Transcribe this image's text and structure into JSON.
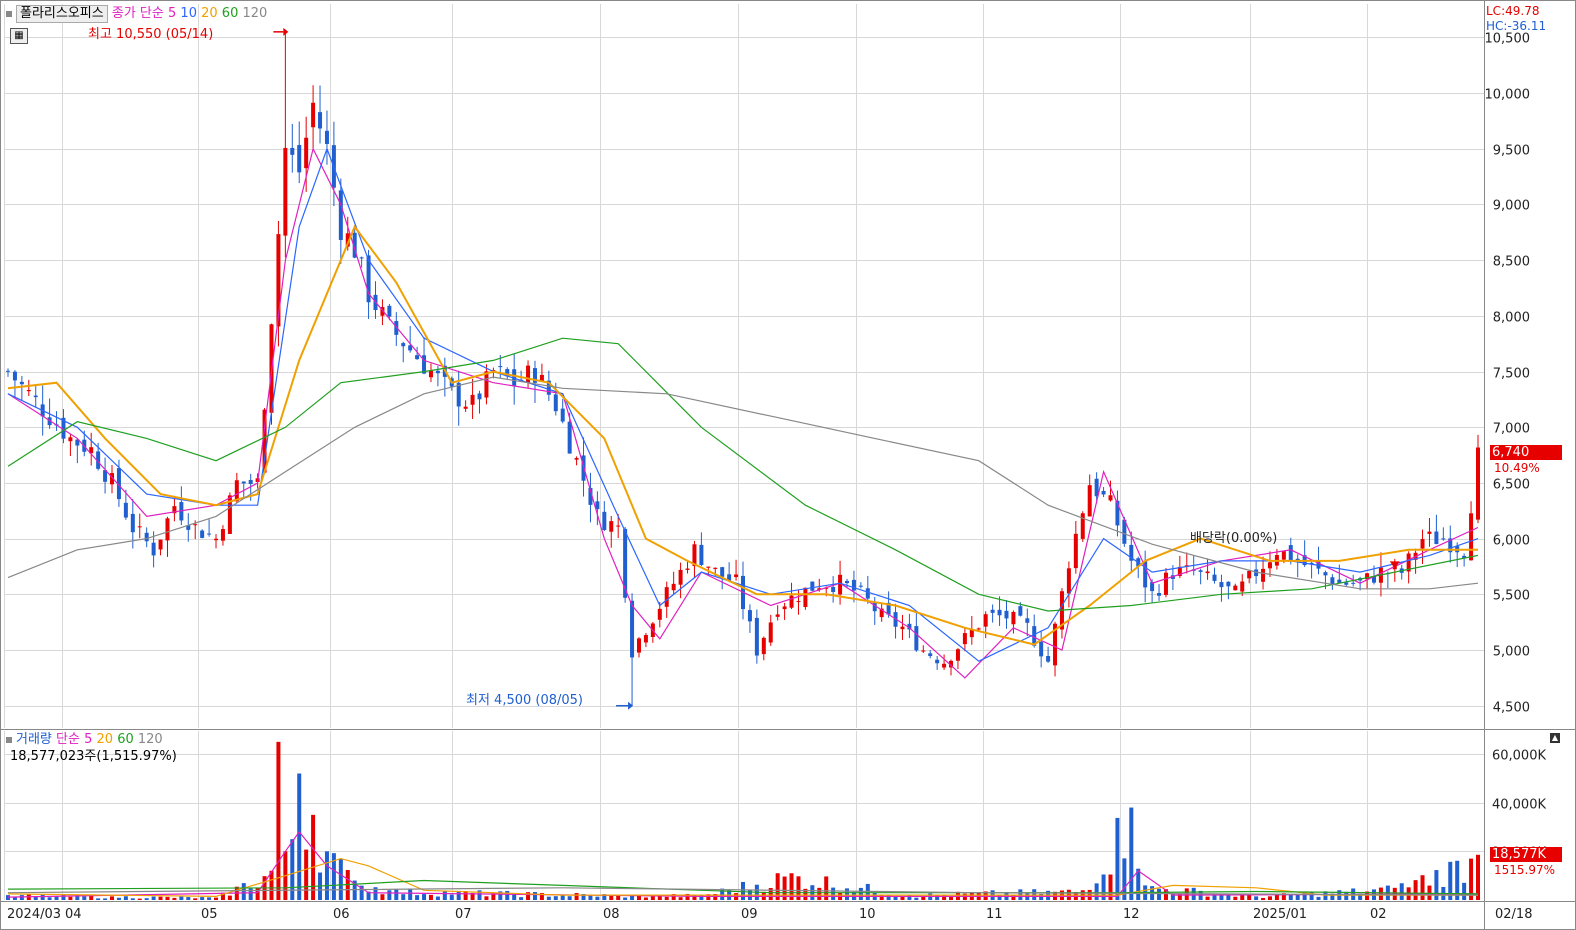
{
  "header": {
    "name": "폴라리스오피스",
    "ma_title": "종가 단순",
    "ma_periods": [
      "5",
      "10",
      "20",
      "60",
      "120"
    ],
    "lc": "LC:49.78",
    "hc": "HC:-36.11"
  },
  "annotations": {
    "high": "최고 10,550 (05/14)",
    "low": "최저 4,500 (08/05)",
    "dividend": "배당락(0.00%)"
  },
  "current": {
    "price": "6,740",
    "change": "10.49%",
    "volume": "18,577K",
    "volume_pct": "1515.97%"
  },
  "volume_header": {
    "title": "거래량",
    "ma_title": "단순",
    "ma_periods": [
      "5",
      "20",
      "60",
      "120"
    ],
    "value": "18,577,023주(1,515.97%)"
  },
  "colors": {
    "up": "#e60000",
    "down": "#1f5fd0",
    "ma5": "#e020c0",
    "ma10": "#2b66ff",
    "ma20": "#f0a000",
    "ma60": "#20a020",
    "ma120": "#888888"
  },
  "chart_data": {
    "type": "candlestick",
    "price_axis": {
      "ticks": [
        "4,500",
        "5,000",
        "5,500",
        "6,000",
        "6,500",
        "7,000",
        "7,500",
        "8,000",
        "8,500",
        "9,000",
        "9,500",
        "10,000",
        "10,500"
      ],
      "ylim": [
        4300,
        10800
      ]
    },
    "volume_axis": {
      "ticks": [
        "20,000K",
        "40,000K",
        "60,000K"
      ],
      "ylim": [
        0,
        67000
      ]
    },
    "x_ticks": [
      "2024/03",
      "04",
      "05",
      "06",
      "07",
      "08",
      "09",
      "10",
      "11",
      "12",
      "2025/01",
      "02",
      "02/18"
    ],
    "series": [
      {
        "name": "close",
        "points": [
          [
            0,
            7500
          ],
          [
            3,
            7300
          ],
          [
            6,
            7100
          ],
          [
            9,
            6900
          ],
          [
            12,
            6800
          ],
          [
            15,
            6500
          ],
          [
            18,
            6100
          ],
          [
            21,
            5900
          ],
          [
            24,
            6300
          ],
          [
            27,
            6100
          ],
          [
            30,
            6000
          ],
          [
            33,
            6500
          ],
          [
            36,
            6500
          ],
          [
            38,
            8000
          ],
          [
            40,
            9500
          ],
          [
            42,
            9300
          ],
          [
            44,
            9900
          ],
          [
            46,
            9500
          ],
          [
            48,
            8800
          ],
          [
            50,
            8600
          ],
          [
            52,
            8200
          ],
          [
            55,
            7900
          ],
          [
            58,
            7700
          ],
          [
            61,
            7500
          ],
          [
            64,
            7300
          ],
          [
            67,
            7200
          ],
          [
            70,
            7500
          ],
          [
            73,
            7400
          ],
          [
            76,
            7500
          ],
          [
            79,
            7200
          ],
          [
            82,
            6700
          ],
          [
            85,
            6200
          ],
          [
            88,
            6100
          ],
          [
            90,
            5000
          ],
          [
            93,
            5300
          ],
          [
            96,
            5600
          ],
          [
            99,
            5900
          ],
          [
            102,
            5700
          ],
          [
            105,
            5600
          ],
          [
            108,
            5000
          ],
          [
            111,
            5400
          ],
          [
            114,
            5500
          ],
          [
            117,
            5600
          ],
          [
            120,
            5600
          ],
          [
            123,
            5500
          ],
          [
            126,
            5300
          ],
          [
            129,
            5200
          ],
          [
            132,
            5000
          ],
          [
            135,
            4900
          ],
          [
            138,
            5100
          ],
          [
            141,
            5300
          ],
          [
            144,
            5300
          ],
          [
            147,
            5200
          ],
          [
            150,
            4900
          ],
          [
            153,
            5800
          ],
          [
            156,
            6500
          ],
          [
            159,
            6300
          ],
          [
            162,
            5800
          ],
          [
            165,
            5500
          ],
          [
            168,
            5700
          ],
          [
            171,
            5700
          ],
          [
            174,
            5600
          ],
          [
            177,
            5500
          ],
          [
            180,
            5700
          ],
          [
            183,
            5900
          ],
          [
            186,
            5800
          ],
          [
            189,
            5700
          ],
          [
            192,
            5600
          ],
          [
            195,
            5600
          ],
          [
            198,
            5700
          ],
          [
            201,
            5700
          ],
          [
            204,
            6000
          ],
          [
            207,
            6000
          ],
          [
            210,
            5900
          ],
          [
            212,
            6740
          ]
        ]
      },
      {
        "name": "volume",
        "points": [
          [
            0,
            2000
          ],
          [
            15,
            1500
          ],
          [
            30,
            1000
          ],
          [
            38,
            12000
          ],
          [
            39,
            65000
          ],
          [
            40,
            20000
          ],
          [
            41,
            25000
          ],
          [
            42,
            52000
          ],
          [
            44,
            35000
          ],
          [
            46,
            20000
          ],
          [
            50,
            8000
          ],
          [
            55,
            4000
          ],
          [
            70,
            3000
          ],
          [
            90,
            2000
          ],
          [
            100,
            2000
          ],
          [
            113,
            11000
          ],
          [
            130,
            2000
          ],
          [
            140,
            3000
          ],
          [
            155,
            4000
          ],
          [
            162,
            38000
          ],
          [
            164,
            6000
          ],
          [
            180,
            1500
          ],
          [
            200,
            5000
          ],
          [
            212,
            18577
          ]
        ]
      }
    ],
    "moving_averages": {
      "5": {
        "points": [
          [
            0,
            7300
          ],
          [
            10,
            6900
          ],
          [
            20,
            6200
          ],
          [
            30,
            6300
          ],
          [
            36,
            6500
          ],
          [
            40,
            8500
          ],
          [
            44,
            9500
          ],
          [
            48,
            9000
          ],
          [
            52,
            8200
          ],
          [
            60,
            7600
          ],
          [
            70,
            7400
          ],
          [
            80,
            7300
          ],
          [
            86,
            6000
          ],
          [
            90,
            5400
          ],
          [
            94,
            5100
          ],
          [
            100,
            5700
          ],
          [
            110,
            5400
          ],
          [
            120,
            5600
          ],
          [
            130,
            5200
          ],
          [
            138,
            4750
          ],
          [
            145,
            5200
          ],
          [
            152,
            5000
          ],
          [
            158,
            6600
          ],
          [
            165,
            5600
          ],
          [
            175,
            5800
          ],
          [
            185,
            5900
          ],
          [
            195,
            5600
          ],
          [
            205,
            5900
          ],
          [
            212,
            6100
          ]
        ]
      },
      "10": {
        "points": [
          [
            0,
            7300
          ],
          [
            10,
            7000
          ],
          [
            20,
            6400
          ],
          [
            30,
            6300
          ],
          [
            36,
            6300
          ],
          [
            42,
            8800
          ],
          [
            46,
            9500
          ],
          [
            52,
            8500
          ],
          [
            60,
            7800
          ],
          [
            70,
            7500
          ],
          [
            80,
            7300
          ],
          [
            88,
            6200
          ],
          [
            94,
            5400
          ],
          [
            100,
            5700
          ],
          [
            110,
            5500
          ],
          [
            120,
            5600
          ],
          [
            130,
            5400
          ],
          [
            140,
            4900
          ],
          [
            150,
            5200
          ],
          [
            158,
            6000
          ],
          [
            165,
            5700
          ],
          [
            175,
            5800
          ],
          [
            185,
            5800
          ],
          [
            195,
            5700
          ],
          [
            205,
            5850
          ],
          [
            212,
            6000
          ]
        ]
      },
      "20": {
        "points": [
          [
            0,
            7350
          ],
          [
            7,
            7400
          ],
          [
            14,
            6900
          ],
          [
            22,
            6400
          ],
          [
            30,
            6300
          ],
          [
            36,
            6400
          ],
          [
            42,
            7600
          ],
          [
            50,
            8800
          ],
          [
            56,
            8300
          ],
          [
            64,
            7400
          ],
          [
            70,
            7500
          ],
          [
            78,
            7400
          ],
          [
            86,
            6900
          ],
          [
            92,
            6000
          ],
          [
            98,
            5800
          ],
          [
            108,
            5500
          ],
          [
            118,
            5500
          ],
          [
            128,
            5400
          ],
          [
            138,
            5200
          ],
          [
            148,
            5050
          ],
          [
            156,
            5400
          ],
          [
            164,
            5800
          ],
          [
            172,
            6000
          ],
          [
            182,
            5800
          ],
          [
            192,
            5800
          ],
          [
            202,
            5900
          ],
          [
            212,
            5900
          ]
        ]
      },
      "60": {
        "points": [
          [
            0,
            6650
          ],
          [
            10,
            7050
          ],
          [
            20,
            6900
          ],
          [
            30,
            6700
          ],
          [
            40,
            7000
          ],
          [
            48,
            7400
          ],
          [
            60,
            7500
          ],
          [
            70,
            7600
          ],
          [
            80,
            7800
          ],
          [
            88,
            7750
          ],
          [
            100,
            7000
          ],
          [
            115,
            6300
          ],
          [
            128,
            5900
          ],
          [
            140,
            5500
          ],
          [
            150,
            5350
          ],
          [
            162,
            5400
          ],
          [
            175,
            5500
          ],
          [
            188,
            5550
          ],
          [
            200,
            5700
          ],
          [
            212,
            5850
          ]
        ]
      },
      "120": {
        "points": [
          [
            0,
            5650
          ],
          [
            10,
            5900
          ],
          [
            20,
            6000
          ],
          [
            30,
            6200
          ],
          [
            40,
            6600
          ],
          [
            50,
            7000
          ],
          [
            60,
            7300
          ],
          [
            70,
            7450
          ],
          [
            80,
            7350
          ],
          [
            95,
            7300
          ],
          [
            110,
            7100
          ],
          [
            125,
            6900
          ],
          [
            140,
            6700
          ],
          [
            150,
            6300
          ],
          [
            165,
            5950
          ],
          [
            180,
            5700
          ],
          [
            195,
            5550
          ],
          [
            205,
            5550
          ],
          [
            212,
            5600
          ]
        ]
      }
    }
  }
}
